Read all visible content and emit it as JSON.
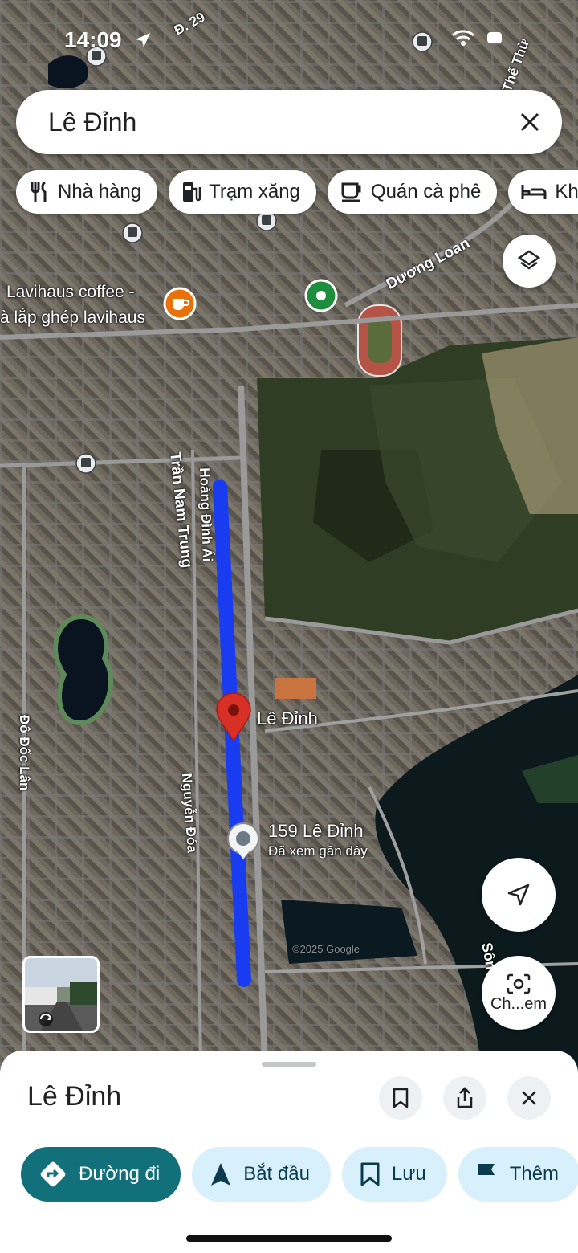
{
  "status": {
    "time": "14:09"
  },
  "search": {
    "query": "Lê Đỉnh"
  },
  "chips": [
    {
      "label": "Nhà hàng",
      "icon": "fork-knife-icon"
    },
    {
      "label": "Trạm xăng",
      "icon": "gas-station-icon"
    },
    {
      "label": "Quán cà phê",
      "icon": "coffee-cup-icon"
    },
    {
      "label": "Kha",
      "icon": "bed-icon"
    }
  ],
  "map": {
    "poi_coffee_line1": "Lavihaus coffee -",
    "poi_coffee_line2": "à lắp ghép lavihaus",
    "streets": {
      "duong_loan": "Dương Loan",
      "tran_nam_trung": "Trần Nam Trung",
      "hoang_dinh_ai": "Hoàng Đình Ái",
      "nguyen_doa": "Nguyễn Đóa",
      "do_doc_lan": "Đô Đốc Lân",
      "d29": "Đ. 29",
      "song": "Sôn",
      "the_thu": "Thế Thừ"
    },
    "pin_label": "Lê Đỉnh",
    "recent_title": "159 Lê Đỉnh",
    "recent_subtitle": "Đã xem gần đây",
    "watermark": "©2025 Google",
    "screenshot_label": "Ch...em"
  },
  "sheet": {
    "title": "Lê Đỉnh"
  },
  "actions": [
    {
      "label": "Đường đi",
      "icon": "directions-icon",
      "primary": true
    },
    {
      "label": "Bắt đầu",
      "icon": "navigation-arrow-icon"
    },
    {
      "label": "Lưu",
      "icon": "bookmark-icon"
    },
    {
      "label": "Thêm",
      "icon": "flag-icon"
    }
  ],
  "colors": {
    "route": "#1a3cf0",
    "pin": "#d93025",
    "primary_action": "#11707a",
    "action_bg": "#d7f0fb"
  }
}
